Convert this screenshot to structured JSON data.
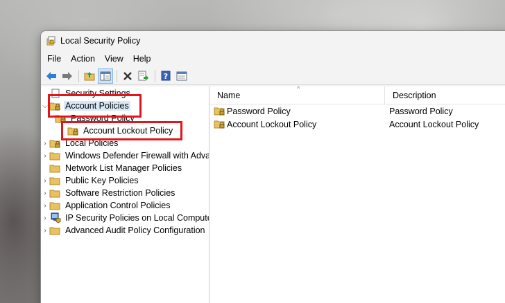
{
  "window": {
    "title": "Local Security Policy"
  },
  "menu": [
    "File",
    "Action",
    "View",
    "Help"
  ],
  "toolbar": {
    "buttons": [
      "back-icon",
      "forward-icon",
      "up-folder-icon",
      "show-hide-tree-icon",
      "delete-icon",
      "export-list-icon",
      "help-icon",
      "properties-icon"
    ]
  },
  "tree": {
    "root": "Security Settings",
    "items": [
      {
        "label": "Account Policies",
        "expanded": true,
        "selected": true
      },
      {
        "label": "Password Policy"
      },
      {
        "label": "Account Lockout Policy"
      },
      {
        "label": "Local Policies"
      },
      {
        "label": "Windows Defender Firewall with Adva"
      },
      {
        "label": "Network List Manager Policies"
      },
      {
        "label": "Public Key Policies"
      },
      {
        "label": "Software Restriction Policies"
      },
      {
        "label": "Application Control Policies"
      },
      {
        "label": "IP Security Policies on Local Compute"
      },
      {
        "label": "Advanced Audit Policy Configuration"
      }
    ]
  },
  "list": {
    "columns": [
      "Name",
      "Description"
    ],
    "rows": [
      {
        "name": "Password Policy",
        "description": "Password Policy"
      },
      {
        "name": "Account Lockout Policy",
        "description": "Account Lockout Policy"
      }
    ]
  },
  "colors": {
    "highlight": "#e3141b",
    "selection": "#d9e8f8",
    "folder": "#e8c160"
  }
}
